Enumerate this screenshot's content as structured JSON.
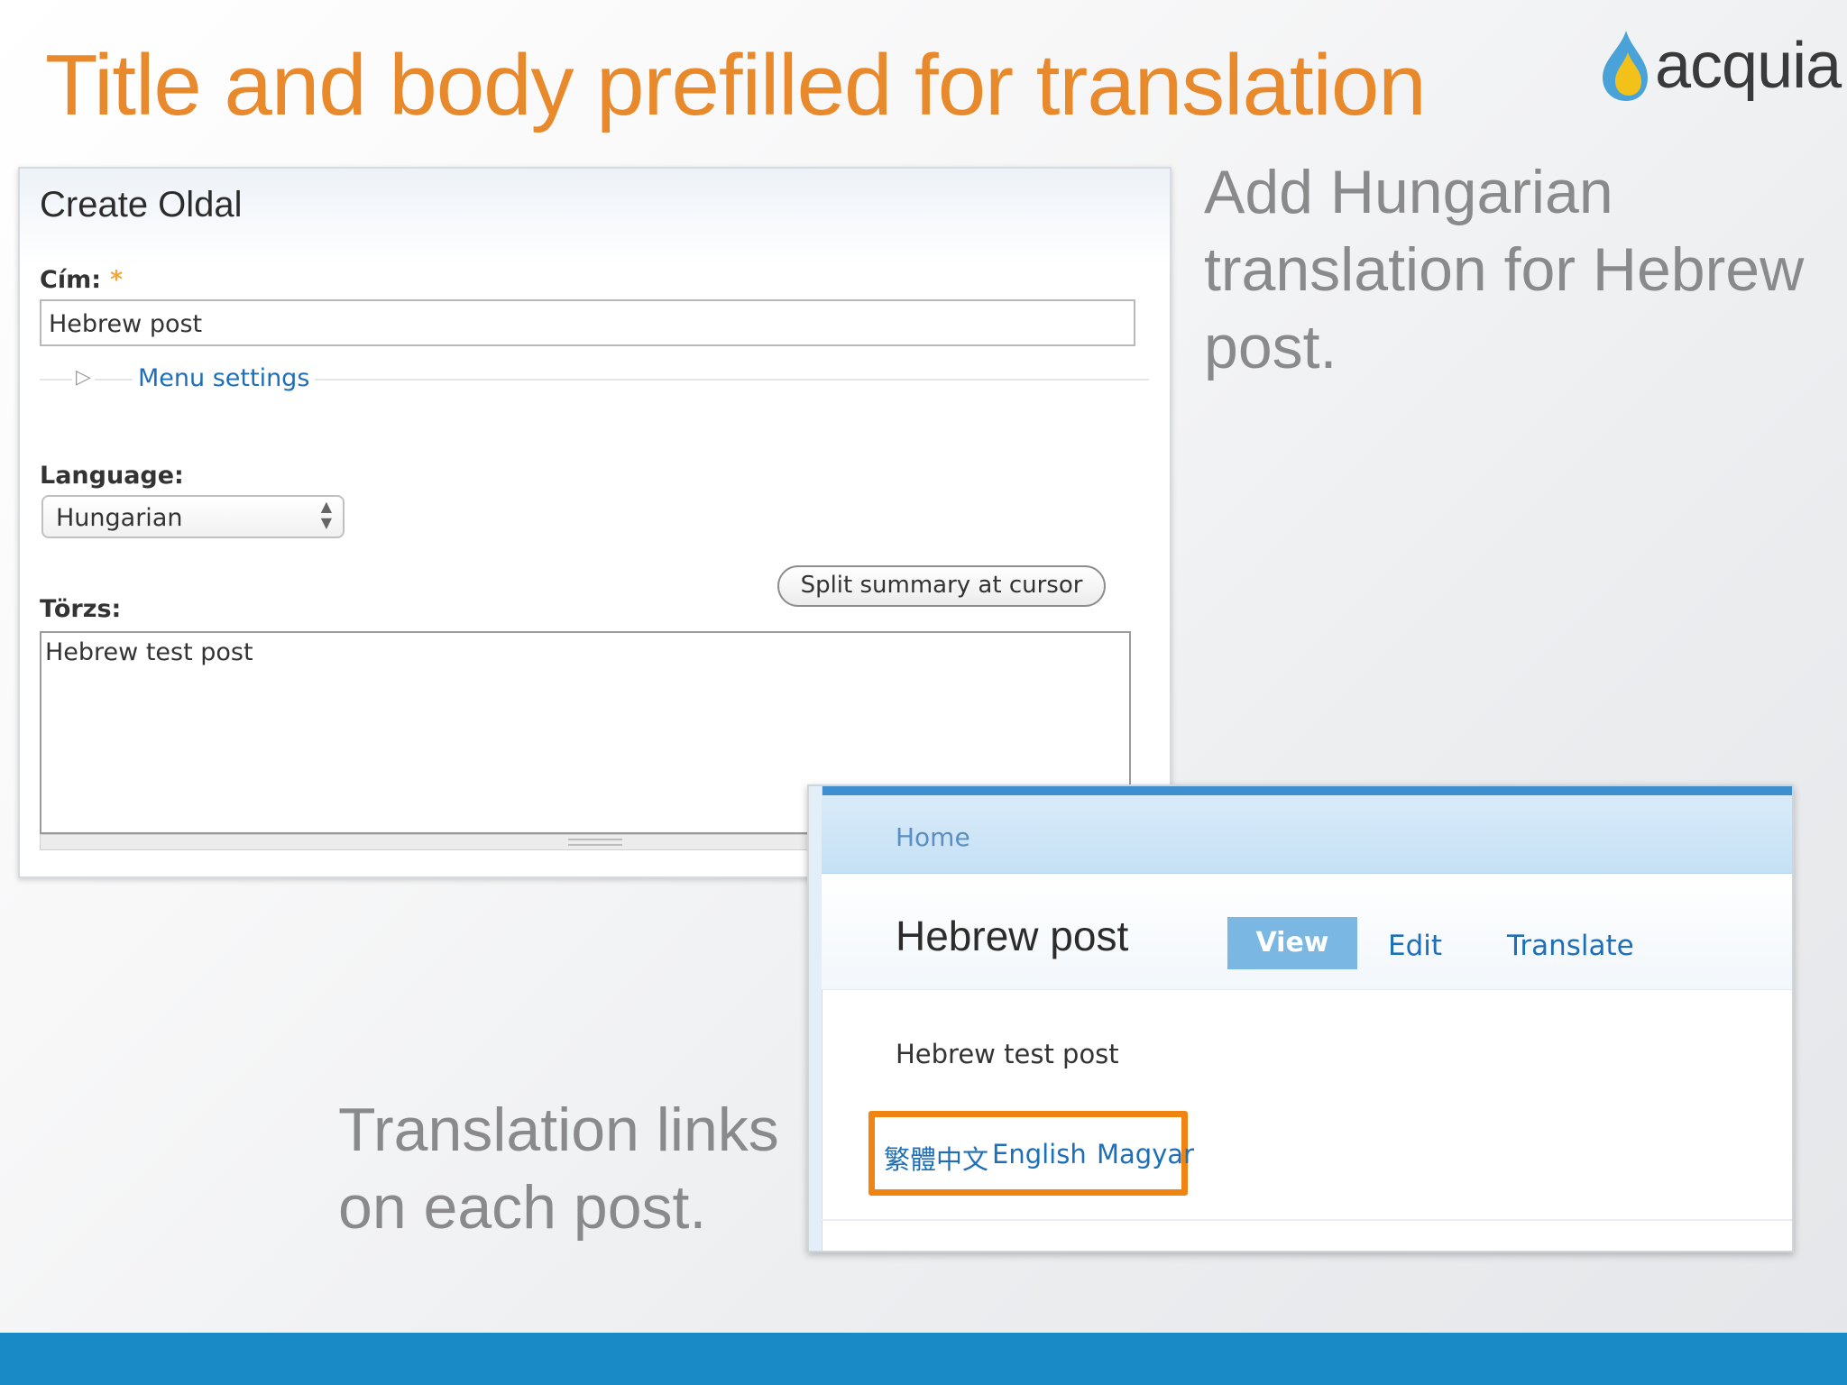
{
  "slide": {
    "title": "Title and body prefilled for translation",
    "logo_text": "acquia",
    "caption_top": "Add Hungarian translation for Hebrew post.",
    "caption_bottom": "Translation links on each post."
  },
  "form": {
    "heading": "Create Oldal",
    "title_label": "Cím:",
    "required_mark": "*",
    "title_value": "Hebrew post",
    "menu_settings": "Menu settings",
    "language_label": "Language:",
    "language_value": "Hungarian",
    "split_button": "Split summary at cursor",
    "body_label": "Törzs:",
    "body_value": "Hebrew test post"
  },
  "node": {
    "breadcrumb": "Home",
    "title": "Hebrew post",
    "tabs": [
      "View",
      "Edit",
      "Translate"
    ],
    "body": "Hebrew test post",
    "languages": [
      "繁體中文",
      "English",
      "Magyar"
    ]
  },
  "colors": {
    "title_orange": "#e8892b",
    "highlight_orange": "#ef8412",
    "brand_blue": "#1a8ac7",
    "link_blue": "#1d6fb8"
  }
}
